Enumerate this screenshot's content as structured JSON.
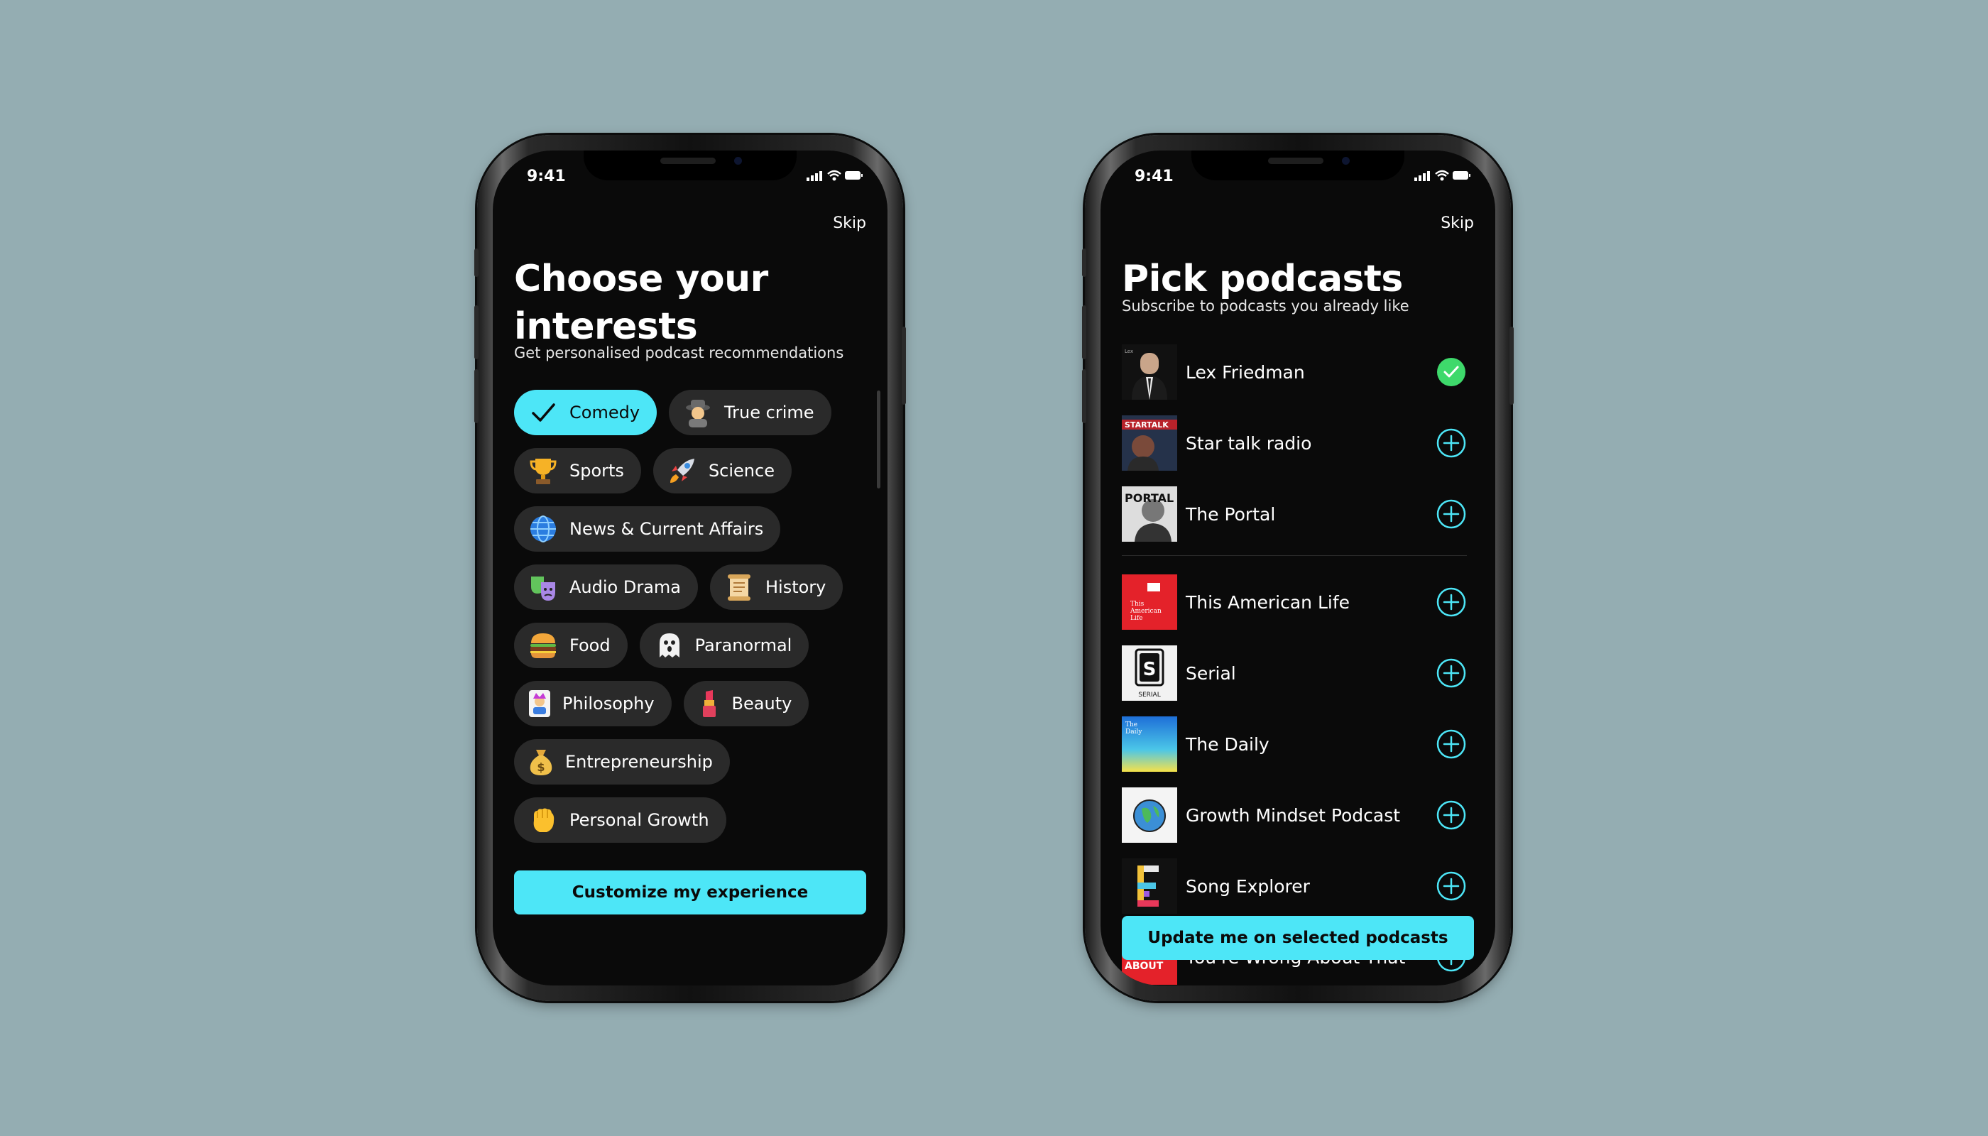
{
  "status": {
    "time": "9:41"
  },
  "interests_screen": {
    "skip": "Skip",
    "title_line1": "Choose your",
    "title_line2": "interests",
    "subtitle": "Get personalised podcast recommendations",
    "chips": [
      {
        "label": "Comedy",
        "icon": "check-icon",
        "selected": true
      },
      {
        "label": "True crime",
        "icon": "detective-icon",
        "selected": false
      },
      {
        "label": "Sports",
        "icon": "trophy-icon",
        "selected": false
      },
      {
        "label": "Science",
        "icon": "rocket-icon",
        "selected": false
      },
      {
        "label": "News & Current Affairs",
        "icon": "globe-icon",
        "selected": false
      },
      {
        "label": "Audio Drama",
        "icon": "theater-masks-icon",
        "selected": false
      },
      {
        "label": "History",
        "icon": "scroll-icon",
        "selected": false
      },
      {
        "label": "Food",
        "icon": "burger-icon",
        "selected": false
      },
      {
        "label": "Paranormal",
        "icon": "ghost-icon",
        "selected": false
      },
      {
        "label": "Philosophy",
        "icon": "joker-card-icon",
        "selected": false
      },
      {
        "label": "Beauty",
        "icon": "lipstick-icon",
        "selected": false
      },
      {
        "label": "Entrepreneurship",
        "icon": "money-bag-icon",
        "selected": false
      },
      {
        "label": "Personal Growth",
        "icon": "raised-fist-icon",
        "selected": false
      }
    ],
    "cta": "Customize my experience"
  },
  "podcasts_screen": {
    "skip": "Skip",
    "title": "Pick podcasts",
    "subtitle": "Subscribe to podcasts you already like",
    "podcasts": [
      {
        "name": "Lex Friedman",
        "selected": true
      },
      {
        "name": "Star talk radio",
        "selected": false
      },
      {
        "name": "The Portal",
        "selected": false
      },
      {
        "name": "This American Life",
        "selected": false
      },
      {
        "name": "Serial",
        "selected": false
      },
      {
        "name": "The Daily",
        "selected": false
      },
      {
        "name": "Growth Mindset Podcast",
        "selected": false
      },
      {
        "name": "Song Explorer",
        "selected": false
      },
      {
        "name": "You're Wrong About That",
        "selected": false
      }
    ],
    "cta": "Update me on selected podcasts"
  },
  "colors": {
    "background": "#94adb2",
    "accent": "#4de6f7",
    "selected_green": "#3ed96b",
    "screen": "#0a0a0a",
    "chip": "#2a2a2a"
  }
}
